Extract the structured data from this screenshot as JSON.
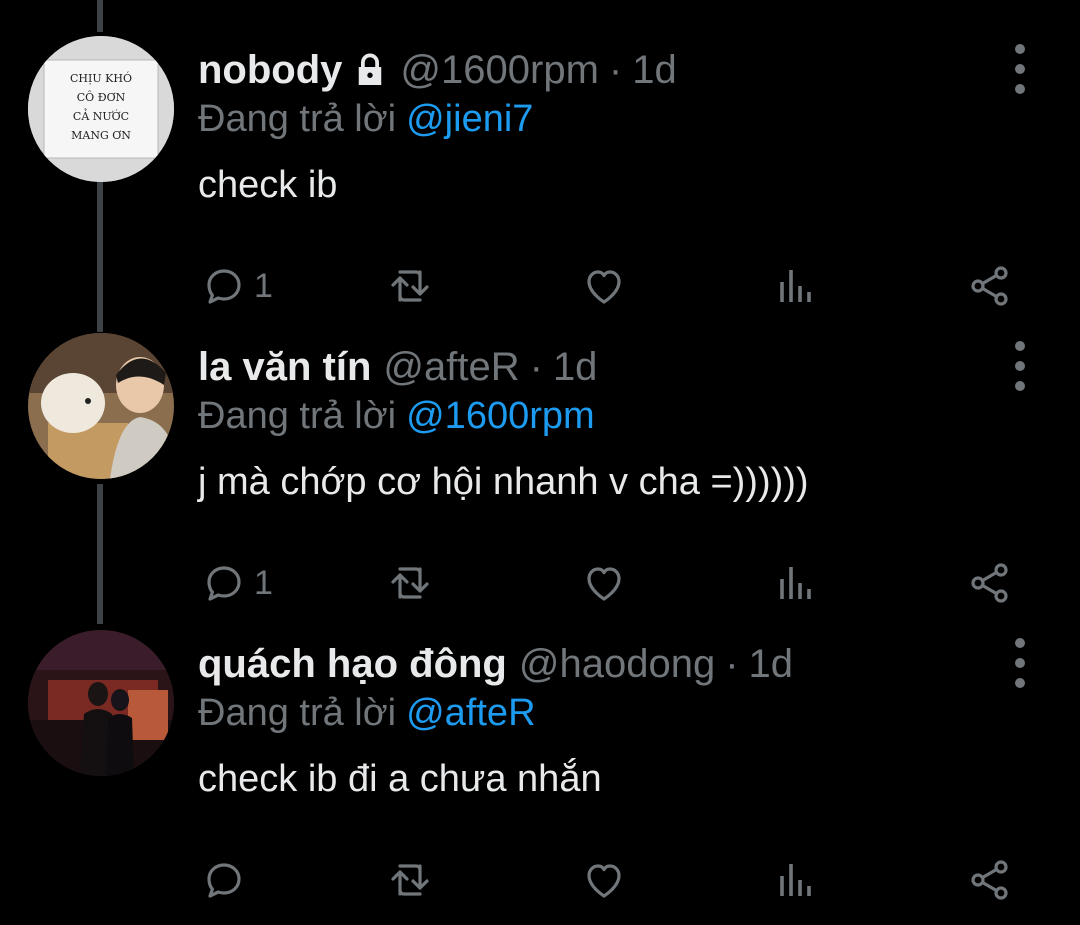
{
  "tweets": [
    {
      "name": "nobody",
      "locked": true,
      "handle": "@1600rpm",
      "separator": "·",
      "time": "1d",
      "reply_prefix": "Đang trả lời",
      "reply_to": "@jieni7",
      "text": "check ib",
      "reply_count": "1",
      "avatar_sign": [
        "CHỊU KHÓ",
        "CÔ ĐƠN",
        "CẢ NƯỚC",
        "MANG ƠN"
      ]
    },
    {
      "name": "la văn tín",
      "locked": false,
      "handle": "@afteR",
      "separator": "·",
      "time": "1d",
      "reply_prefix": "Đang trả lời",
      "reply_to": "@1600rpm",
      "text": "j mà chớp cơ hội nhanh v cha =))))))",
      "reply_count": "1"
    },
    {
      "name": "quách hạo đông",
      "locked": false,
      "handle": "@haodong",
      "separator": "·",
      "time": "1d",
      "reply_prefix": "Đang trả lời",
      "reply_to": "@afteR",
      "text": "check ib đi a chưa nhắn",
      "reply_count": ""
    }
  ],
  "icons": [
    "lock-icon",
    "more-icon",
    "reply-icon",
    "retweet-icon",
    "like-icon",
    "views-icon",
    "share-icon"
  ],
  "colors": {
    "background": "#000000",
    "text": "#e7e9ea",
    "muted": "#71767b",
    "link": "#1d9bf0"
  }
}
